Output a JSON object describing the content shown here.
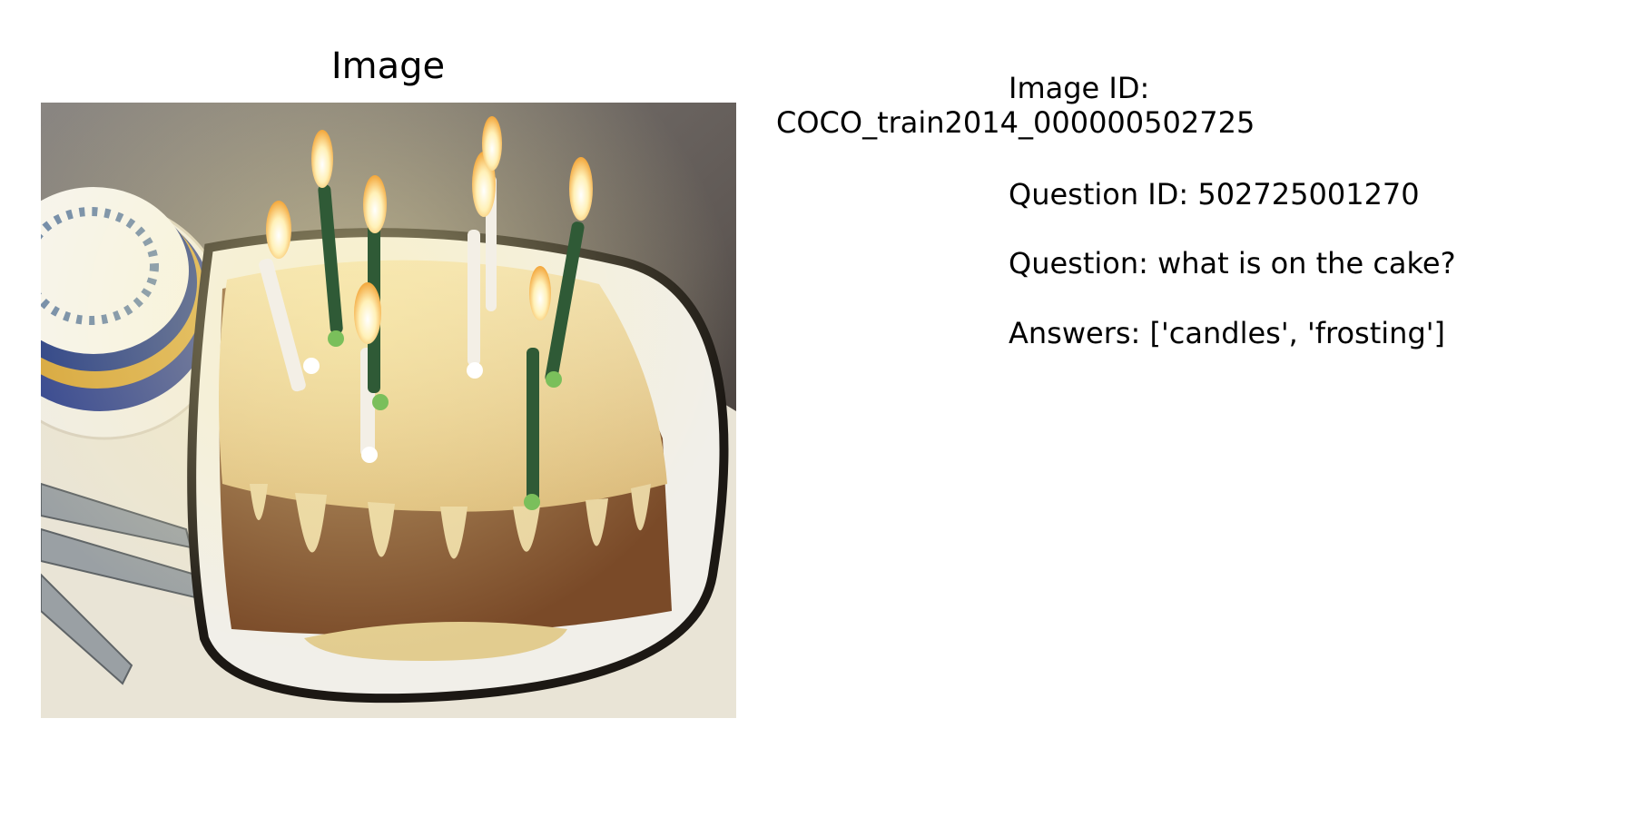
{
  "panel_title": "Image",
  "image_id_label": "Image ID:",
  "image_id_value": "COCO_train2014_000000502725",
  "question_id": "Question ID: 502725001270",
  "question": "Question: what is on the cake?",
  "answers": "Answers: ['candles', 'frosting']",
  "photo_icon": "birthday-cake-photo",
  "colors": {
    "carpet": "#6f6a66",
    "tray": "#f1efe9",
    "tray_rim": "#1c1814",
    "cake_base": "#7a4a28",
    "icing": "#e9d7a8",
    "candle_white": "#f3efe6",
    "candle_green": "#2f5a36",
    "flame": "#fff3c4"
  }
}
